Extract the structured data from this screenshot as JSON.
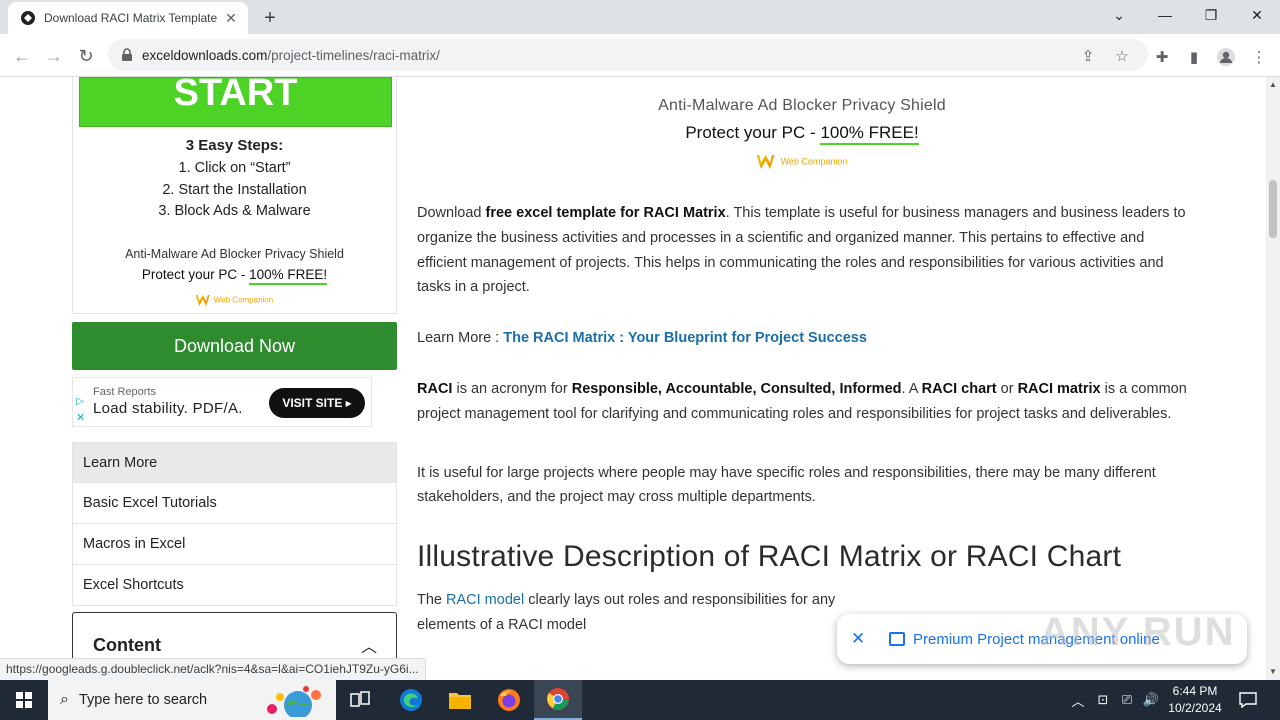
{
  "browser": {
    "tab_title": "Download RACI Matrix Template",
    "url_domain": "exceldownloads.com",
    "url_path": "/project-timelines/raci-matrix/"
  },
  "left_ad": {
    "start_label": "START",
    "steps_heading": "3 Easy Steps:",
    "steps": [
      "1. Click on “Start”",
      "2. Start the Installation",
      "3. Block Ads & Malware"
    ],
    "shield_text": "Anti-Malware Ad Blocker Privacy Shield",
    "protect_prefix": "Protect your PC - ",
    "protect_highlight": "100% FREE!",
    "brand": "Web Companion"
  },
  "download_button": "Download Now",
  "small_ad": {
    "sponsor": "Fast Reports",
    "headline": "Load stability. PDF/A.",
    "cta": "VISIT SITE ▸"
  },
  "sidebar_menu": [
    "Learn More",
    "Basic Excel Tutorials",
    "Macros in Excel",
    "Excel Shortcuts"
  ],
  "content_box": {
    "heading": "Content"
  },
  "right_ad": {
    "shield_text": "Anti-Malware Ad Blocker Privacy Shield",
    "protect_prefix": "Protect your PC - ",
    "protect_highlight": "100% FREE!",
    "brand": "Web Companion"
  },
  "article": {
    "p1_a": "Download ",
    "p1_bold": "free excel template for RACI Matrix",
    "p1_b": ". This template is useful for business managers and business leaders to organize the business activities and processes in a scientific and organized manner. This pertains to effective and efficient management of projects. This helps in communicating the roles and responsibilities for various activities and tasks in a project.",
    "learn_prefix": "Learn More : ",
    "learn_link": "The RACI Matrix : Your Blueprint for Project Success",
    "p3_raci": "RACI",
    "p3_a": " is an acronym for ",
    "p3_terms": "Responsible, Accountable, Consulted, Informed",
    "p3_b": ". A ",
    "p3_chart": "RACI chart",
    "p3_c": " or ",
    "p3_matrix": "RACI matrix",
    "p3_d": " is a common project management tool for clarifying and communicating roles and responsibilities for project tasks and deliverables.",
    "p4": "It is useful for large projects where people may have specific roles and responsibilities, there may be many different stakeholders, and the project may cross multiple departments.",
    "heading": "Illustrative Description of RACI Matrix or RACI Chart",
    "p5_a": "The ",
    "p5_link": "RACI model",
    "p5_b": " clearly lays out roles and responsibilities for any",
    "p6": "elements of a RACI model"
  },
  "toast": {
    "text": "Premium Project management online"
  },
  "watermark": "ANY RUN",
  "status_url": "https://googleads.g.doubleclick.net/aclk?nis=4&sa=l&ai=CO1iehJT9Zu-yG6i...",
  "taskbar": {
    "search_placeholder": "Type here to search",
    "time": "6:44 PM",
    "date": "10/2/2024"
  },
  "colors": {
    "start_green": "#4cd326",
    "download_green": "#2e8b2e",
    "link_blue": "#1a6fa8",
    "toast_blue": "#1a73e8"
  }
}
